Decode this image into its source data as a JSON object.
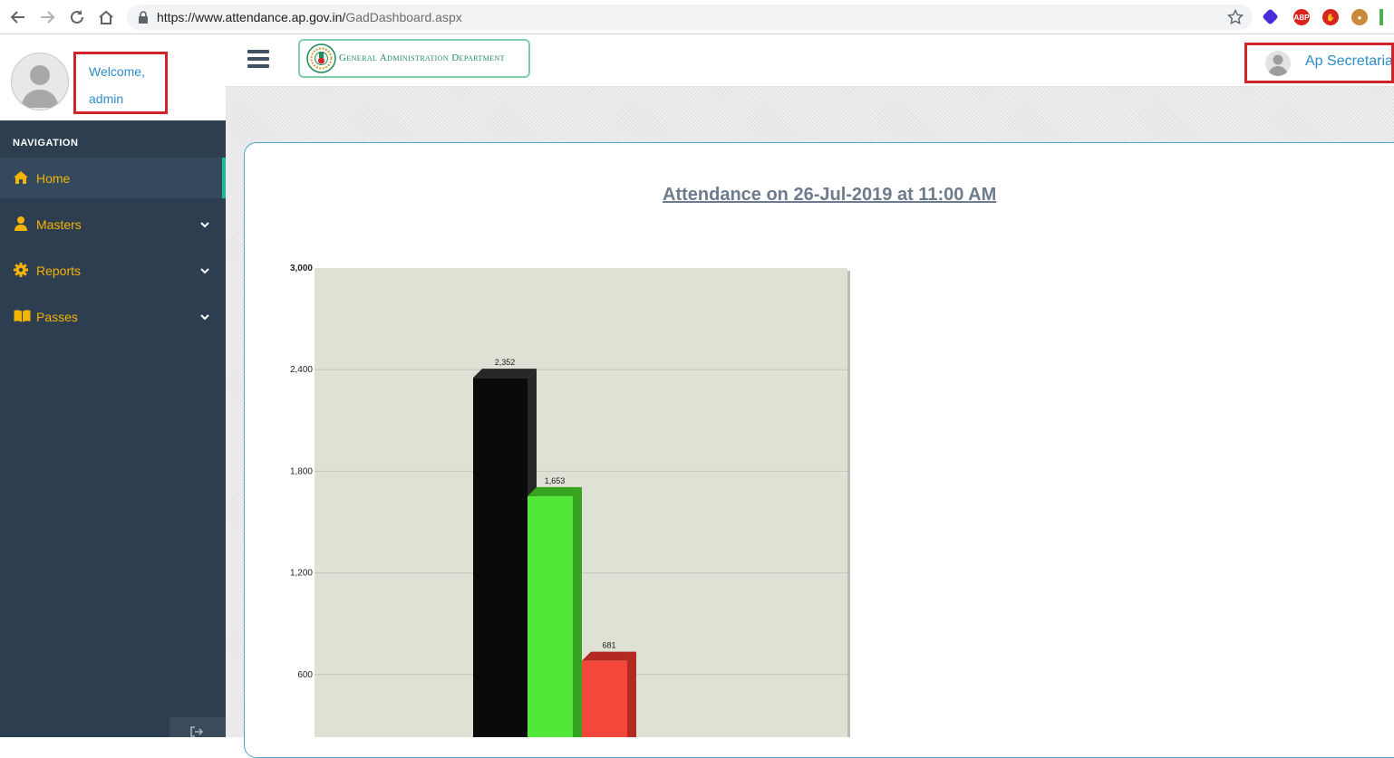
{
  "browser": {
    "url_host": "https://www.attendance.ap.gov.in/",
    "url_path": "GadDashboard.aspx"
  },
  "sidebar": {
    "welcome_line1": "Welcome,",
    "welcome_line2": "admin",
    "nav_heading": "NAVIGATION",
    "items": [
      {
        "label": "Home",
        "icon": "home-icon",
        "active": true
      },
      {
        "label": "Masters",
        "icon": "user-icon",
        "active": false
      },
      {
        "label": "Reports",
        "icon": "gear-icon",
        "active": false
      },
      {
        "label": "Passes",
        "icon": "book-icon",
        "active": false
      }
    ]
  },
  "header": {
    "brand_name": "General Administration Department",
    "user_name": "Ap Secretariat"
  },
  "colors": {
    "sidebar_bg": "#2d3e50",
    "nav_label": "#f4b400",
    "active_indicator": "#1abc9c",
    "highlight_border": "#d2232a",
    "link_blue": "#2e8cc8"
  },
  "chart_data": {
    "type": "bar",
    "title": "Attendance on 26-Jul-2019 at 11:00 AM",
    "ylim": [
      0,
      3000
    ],
    "yticks": [
      600,
      1200,
      1800,
      2400,
      3000
    ],
    "ytick_labels": [
      "600",
      "1,200",
      "1,800",
      "2,400",
      "3,000"
    ],
    "values": [
      2352,
      1653,
      681
    ],
    "value_labels": [
      "2,352",
      "1,653",
      "681"
    ],
    "colors": [
      "#0a0a0a",
      "#52e83a",
      "#f2473a"
    ],
    "grid": true
  }
}
